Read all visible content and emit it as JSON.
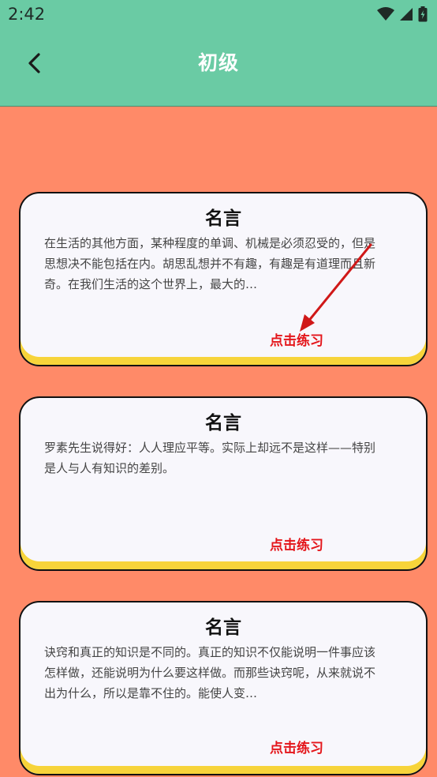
{
  "status_bar": {
    "time": "2:42"
  },
  "app_bar": {
    "title": "初级"
  },
  "cards": [
    {
      "title": "名言",
      "text": "在生活的其他方面，某种程度的单调、机械是必须忍受的，但是思想决不能包括在内。胡思乱想并不有趣，有趣是有道理而且新奇。在我们生活的这个世界上，最大的…",
      "action": "点击练习"
    },
    {
      "title": "名言",
      "text": "罗素先生说得好：人人理应平等。实际上却远不是这样——特别是人与人有知识的差别。",
      "action": "点击练习"
    },
    {
      "title": "名言",
      "text": "诀窍和真正的知识是不同的。真正的知识不仅能说明一件事应该怎样做，还能说明为什么要这样做。而那些诀窍呢，从来就说不出为什么，所以是靠不住的。能使人变…",
      "action": "点击练习"
    }
  ],
  "colors": {
    "app_bar": "#6ACBA4",
    "background": "#FF8A68",
    "card": "#F8F7FC",
    "card_accent": "#F7D43A",
    "action_text": "#E4161B"
  }
}
